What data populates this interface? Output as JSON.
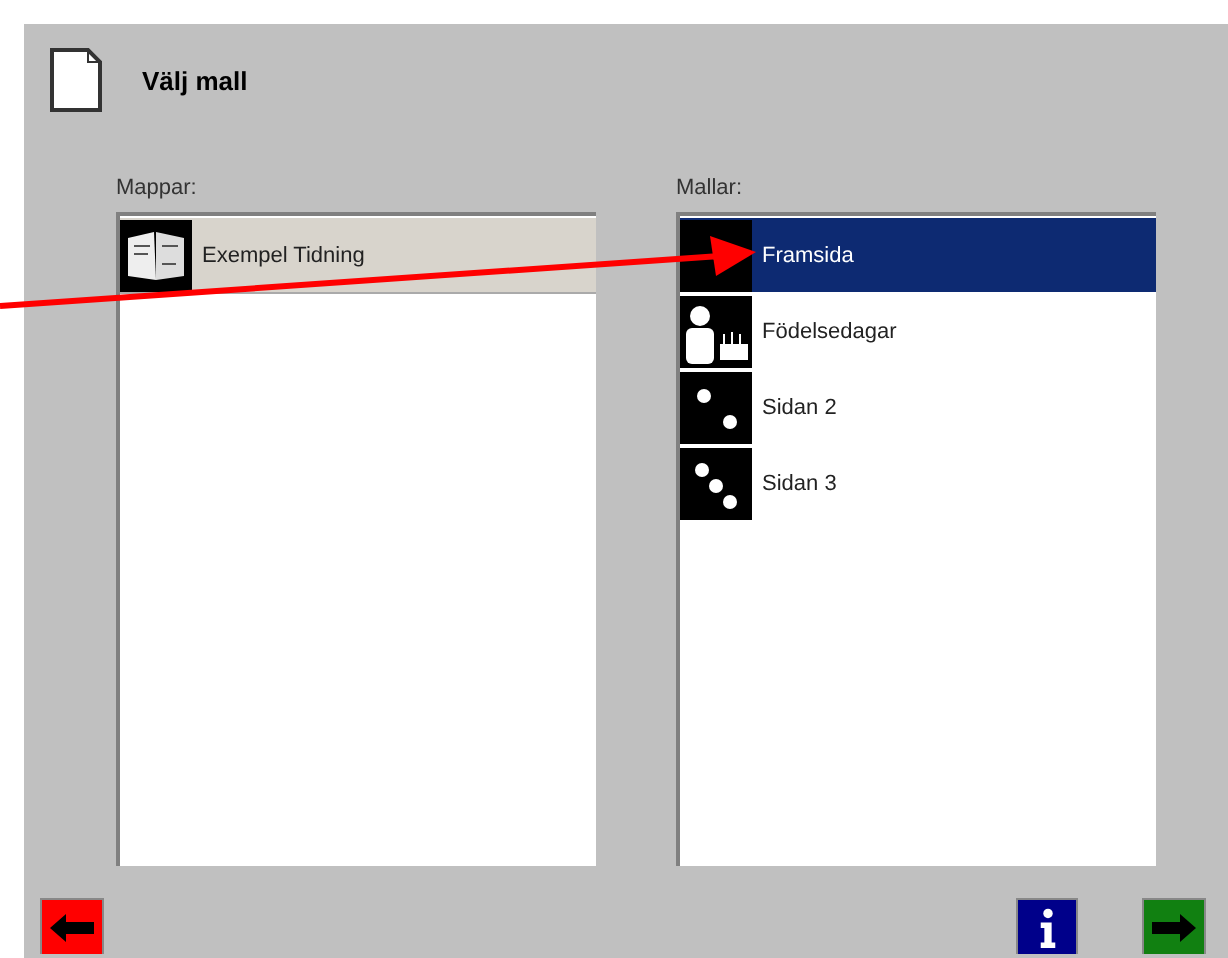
{
  "title": "Välj mall",
  "folders": {
    "label": "Mappar:",
    "items": [
      {
        "label": "Exempel Tidning",
        "kind": "newspaper",
        "selected": true
      }
    ]
  },
  "templates": {
    "label": "Mallar:",
    "items": [
      {
        "label": "Framsida",
        "kind": "dots1",
        "selected": true
      },
      {
        "label": "Födelsedagar",
        "kind": "birthday",
        "selected": false
      },
      {
        "label": "Sidan 2",
        "kind": "dots2",
        "selected": false
      },
      {
        "label": "Sidan 3",
        "kind": "dots3",
        "selected": false
      }
    ]
  }
}
